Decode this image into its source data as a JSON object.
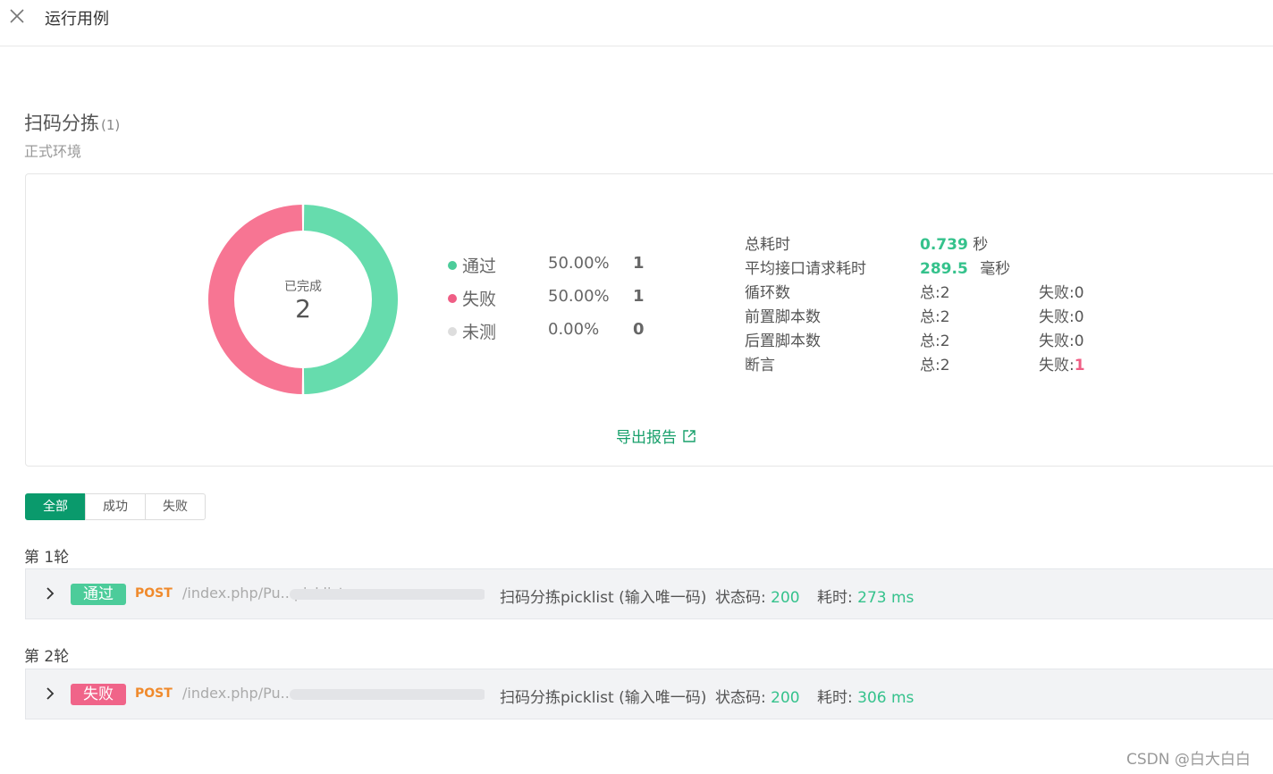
{
  "header": {
    "title": "运行用例",
    "close_icon": "close-icon"
  },
  "suite": {
    "title": "扫码分拣",
    "count": "(1)",
    "environment": "正式环境"
  },
  "summary": {
    "donut_label": "已完成",
    "donut_value": "2",
    "colors": {
      "pass": "#66dcad",
      "fail": "#f77593",
      "untested": "#dddddd"
    },
    "legend": [
      {
        "name": "通过",
        "percent": "50.00%",
        "count": "1"
      },
      {
        "name": "失败",
        "percent": "50.00%",
        "count": "1"
      },
      {
        "name": "未测",
        "percent": "0.00%",
        "count": "0"
      }
    ],
    "stats": {
      "total_time_label": "总耗时",
      "total_time_value": "0.739",
      "total_time_unit": "秒",
      "avg_time_label": "平均接口请求耗时",
      "avg_time_value": "289.5",
      "avg_time_unit": "毫秒",
      "rows": [
        {
          "label": "循环数",
          "total": "总:2",
          "fail_prefix": "失败:",
          "fail": "0"
        },
        {
          "label": "前置脚本数",
          "total": "总:2",
          "fail_prefix": "失败:",
          "fail": "0"
        },
        {
          "label": "后置脚本数",
          "total": "总:2",
          "fail_prefix": "失败:",
          "fail": "0"
        },
        {
          "label": "断言",
          "total": "总:2",
          "fail_prefix": "失败:",
          "fail": "1"
        }
      ]
    },
    "export_label": "导出报告"
  },
  "filters": [
    "全部",
    "成功",
    "失败"
  ],
  "rounds": [
    {
      "label": "第 1轮",
      "status": "通过",
      "method": "POST",
      "url": "/index.php/Pu...picklist",
      "case_name": "扫码分拣picklist (输入唯一码)",
      "status_code_label": "状态码:",
      "status_code": "200",
      "time_label": "耗时:",
      "time": "273 ms"
    },
    {
      "label": "第 2轮",
      "status": "失败",
      "method": "POST",
      "url": "/index.php/Pu...",
      "case_name": "扫码分拣picklist (输入唯一码)",
      "status_code_label": "状态码:",
      "status_code": "200",
      "time_label": "耗时:",
      "time": "306 ms"
    }
  ],
  "watermark": "CSDN @白大白白"
}
